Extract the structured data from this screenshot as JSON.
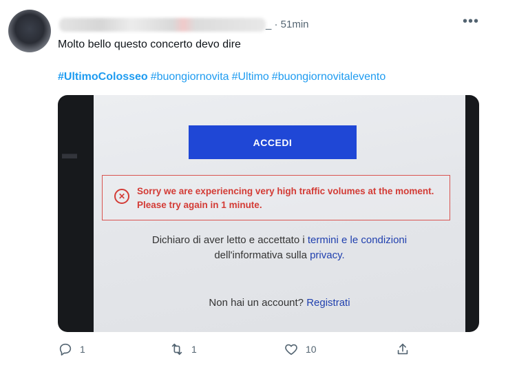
{
  "tweet": {
    "timestamp": "_ · 51min",
    "text": "Molto bello questo concerto devo dire",
    "hashtags": [
      "#UltimoColosseo",
      "#buongiornovita",
      "#Ultimo",
      "#buongiornovitalevento"
    ],
    "more_icon": "more-horizontal-icon"
  },
  "media": {
    "accedi_label": "ACCEDI",
    "error_message": "Sorry we are experiencing very high traffic volumes at the moment. Please try again in 1 minute.",
    "error_icon": "close-circle-icon",
    "consent_line1_prefix": "Dichiaro di aver letto e accettato i",
    "consent_link1": "termini e le condizioni",
    "consent_line2_prefix": "dell'informativa sulla",
    "consent_link2": "privacy.",
    "signup_prefix": "Non hai un account?",
    "signup_link": "Registrati",
    "colors": {
      "button": "#1f47d6",
      "error": "#d33b35",
      "link": "#1f3fae"
    }
  },
  "actions": {
    "reply_count": "1",
    "retweet_count": "1",
    "like_count": "10",
    "icons": [
      "reply-icon",
      "retweet-icon",
      "like-icon",
      "share-icon"
    ]
  },
  "colors": {
    "accent": "#1d9bf0",
    "secondary_text": "#536471"
  }
}
